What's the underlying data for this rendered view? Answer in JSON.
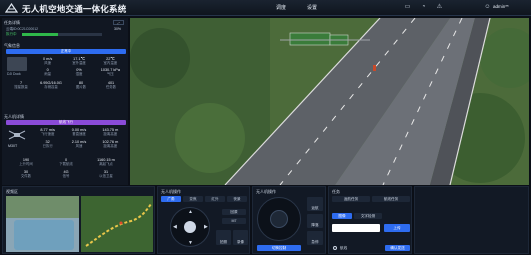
{
  "header": {
    "title": "无人机空地交通一体化系统",
    "nav": [
      "调度",
      "设置"
    ],
    "user": "admin**"
  },
  "uav_status": {
    "heading": "任务详情",
    "device_id": "云端ID:0C21C00012",
    "device_val": "30%",
    "progress_label": "执行中",
    "progress": 0.45
  },
  "weather": {
    "heading": "气象信息",
    "bar": "正常中",
    "row1": [
      {
        "v": "0 m/s",
        "l": "风速"
      },
      {
        "v": "17.1℃",
        "l": "室外温度"
      },
      {
        "v": "22℃",
        "l": "室内温度"
      }
    ],
    "row2": [
      {
        "v": "0",
        "l": "雨量"
      },
      {
        "v": "0%",
        "l": "湿度"
      },
      {
        "v": "1030.7 kPa",
        "l": "气压"
      }
    ],
    "row3": [
      {
        "v": "7",
        "l": "搜星数量"
      },
      {
        "v": "6.95G/16.0G",
        "l": "存储容量"
      },
      {
        "v": "80",
        "l": "图片数"
      },
      {
        "v": "401",
        "l": "任务数"
      }
    ],
    "device_label": "DJI Dock"
  },
  "drone": {
    "heading": "无人机详情",
    "bar": "航线飞行",
    "model": "M30T",
    "row1": [
      {
        "v": "8.77 m/s",
        "l": "飞行速度"
      },
      {
        "v": "0.00 m/s",
        "l": "垂直速度"
      },
      {
        "v": "143.75 m",
        "l": "距离高度"
      }
    ],
    "row2": [
      {
        "v": "32",
        "l": "已执行"
      },
      {
        "v": "2.10 m/s",
        "l": "风速"
      },
      {
        "v": "102.76 m",
        "l": "距离高度"
      }
    ],
    "row3": [
      {
        "v": "190",
        "l": "上升时间"
      },
      {
        "v": "0",
        "l": "下载航线"
      },
      {
        "v": "1160.15 m",
        "l": "离起飞点"
      }
    ],
    "row4": [
      {
        "v": "30",
        "l": "文件数"
      },
      {
        "v": "4G",
        "l": "信号"
      },
      {
        "v": "31",
        "l": "以信卫星"
      }
    ]
  },
  "bottom": {
    "panel1": "视频区",
    "panel2": "无人机操作",
    "panel2_tabs": [
      "广角",
      "变焦",
      "红外",
      "夜景"
    ],
    "panel2_btns": [
      "回原",
      "M7",
      "拍照",
      "录像"
    ],
    "panel3": "无人机操作",
    "panel3_btn": "切换控制",
    "panel3_side": [
      "返航",
      "降落",
      "急停"
    ],
    "panel4": "任务",
    "panel4_tabs": [
      "返航任务",
      "航线任务"
    ],
    "panel4_subtabs": [
      "图像",
      "文字检测"
    ],
    "panel4_btn": "上传",
    "panel4_radio": "航线",
    "panel4_bottom_btn": "确认发送"
  },
  "colors": {
    "accent": "#2e6cf0",
    "purple": "#8a4bd8",
    "green": "#2fb84a"
  }
}
